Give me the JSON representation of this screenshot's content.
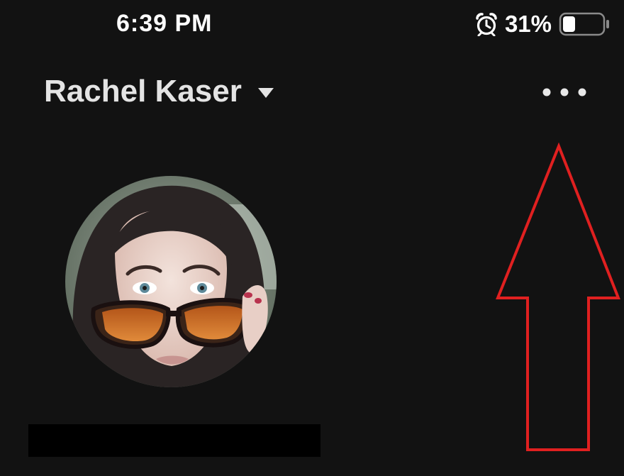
{
  "status_bar": {
    "time": "6:39 PM",
    "battery_percent": "31%",
    "battery_level": 0.31,
    "alarm_icon": "alarm-clock-icon",
    "battery_icon": "battery-icon"
  },
  "header": {
    "profile_name": "Rachel Kaser",
    "dropdown_icon": "caret-down-icon",
    "more_icon": "ellipsis-icon"
  },
  "avatar": {
    "icon": "profile-photo"
  },
  "annotation": {
    "arrow_color": "#e02020",
    "icon": "up-arrow-outline"
  },
  "colors": {
    "background": "#121212",
    "text_primary": "#ffffff",
    "name_text": "#e4e4e4",
    "redaction": "#000000"
  }
}
